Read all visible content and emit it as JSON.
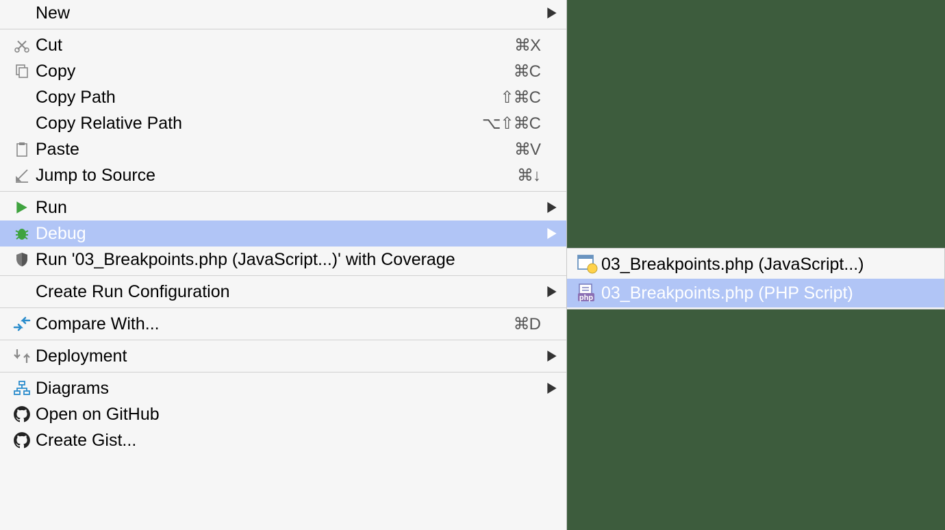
{
  "menu": {
    "new": {
      "label": "New"
    },
    "cut": {
      "label": "Cut",
      "shortcut": "⌘X"
    },
    "copy": {
      "label": "Copy",
      "shortcut": "⌘C"
    },
    "copy_path": {
      "label": "Copy Path",
      "shortcut": "⇧⌘C"
    },
    "copy_relative_path": {
      "label": "Copy Relative Path",
      "shortcut": "⌥⇧⌘C"
    },
    "paste": {
      "label": "Paste",
      "shortcut": "⌘V"
    },
    "jump_to_source": {
      "label": "Jump to Source",
      "shortcut": "⌘↓"
    },
    "run": {
      "label": "Run"
    },
    "debug": {
      "label": "Debug"
    },
    "run_coverage": {
      "label": "Run '03_Breakpoints.php (JavaScript...)' with Coverage"
    },
    "create_run_config": {
      "label": "Create Run Configuration"
    },
    "compare_with": {
      "label": "Compare With...",
      "shortcut": "⌘D"
    },
    "deployment": {
      "label": "Deployment"
    },
    "diagrams": {
      "label": "Diagrams"
    },
    "open_on_github": {
      "label": "Open on GitHub"
    },
    "create_gist": {
      "label": "Create Gist..."
    }
  },
  "submenu": {
    "js": {
      "label": "03_Breakpoints.php (JavaScript...)"
    },
    "php": {
      "label": "03_Breakpoints.php (PHP Script)"
    }
  }
}
